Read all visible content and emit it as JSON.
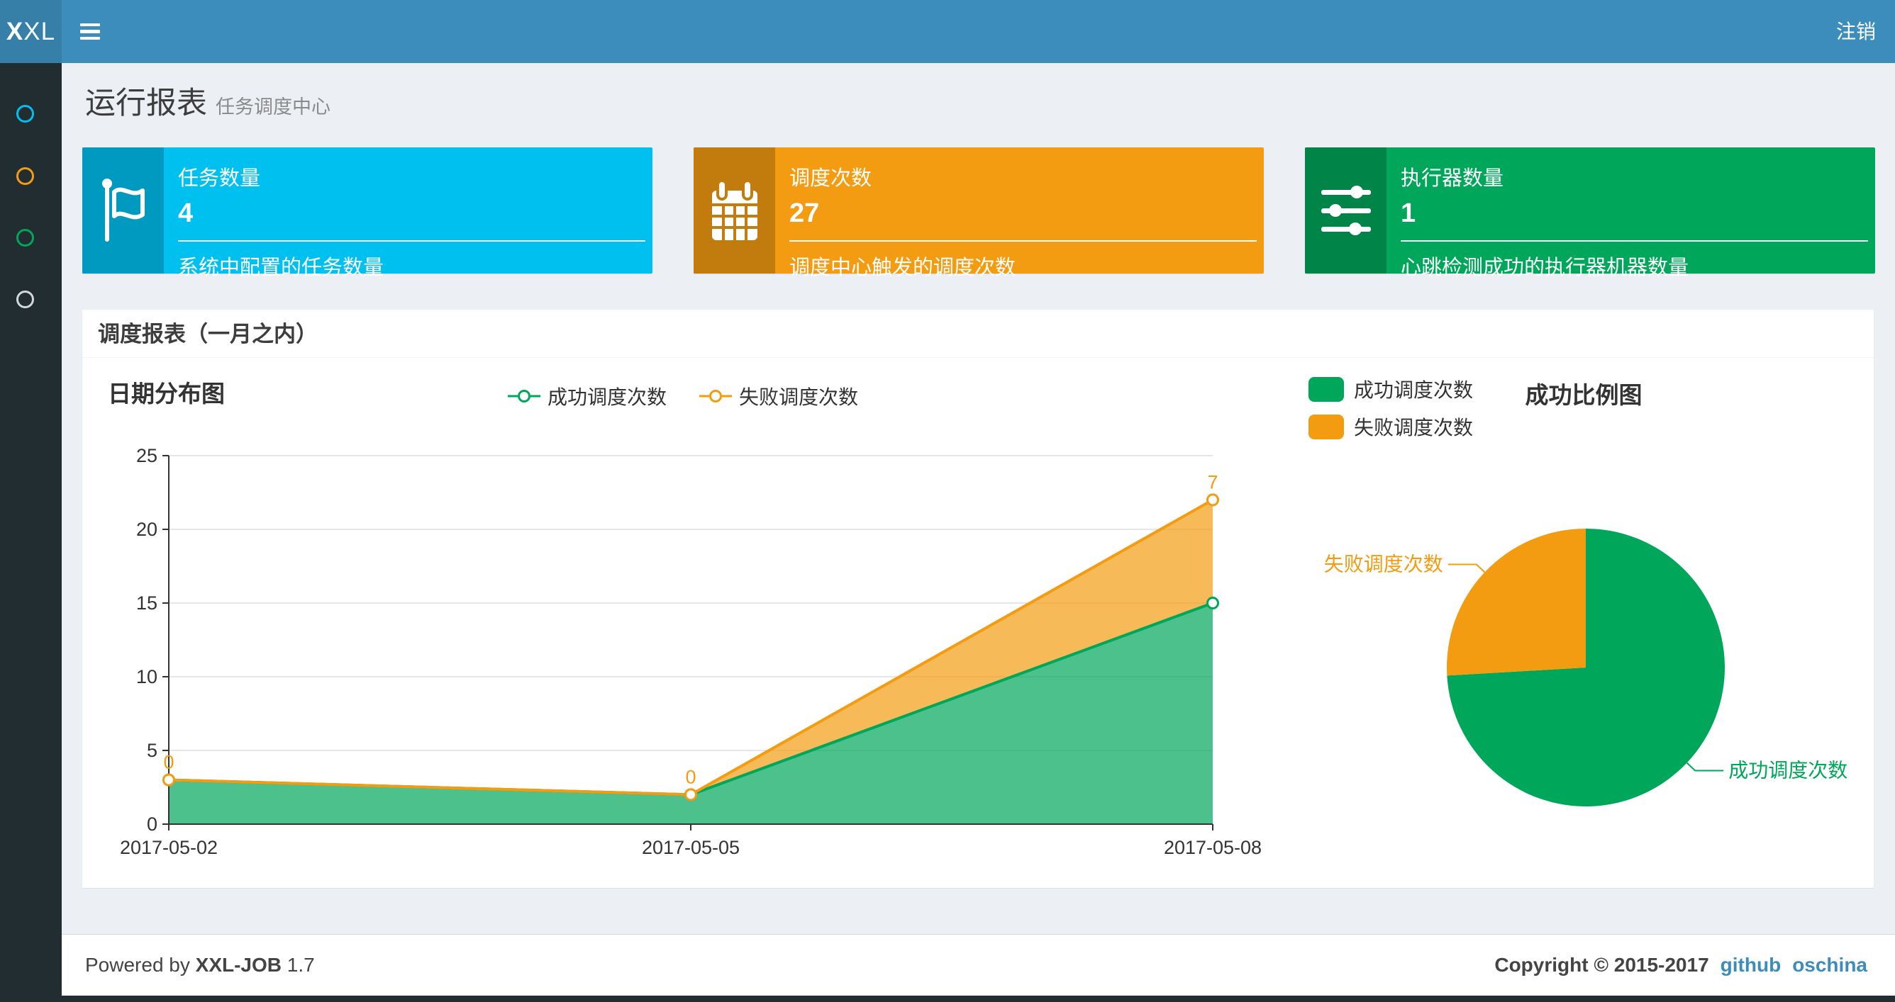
{
  "navbar": {
    "logo_bold": "X",
    "logo_rest": "XL",
    "logout": "注销"
  },
  "sidebar": {
    "items": [
      {
        "icon": "circle-o-icon",
        "color": "#00c0ef"
      },
      {
        "icon": "circle-o-icon",
        "color": "#f39c12"
      },
      {
        "icon": "circle-o-icon",
        "color": "#00a65a"
      },
      {
        "icon": "circle-o-icon",
        "color": "#d2d6de"
      }
    ]
  },
  "header": {
    "title": "运行报表",
    "subtitle": "任务调度中心"
  },
  "info_boxes": [
    {
      "label": "任务数量",
      "value": "4",
      "description": "系统中配置的任务数量",
      "color": "#00c0ef",
      "icon": "flag-icon"
    },
    {
      "label": "调度次数",
      "value": "27",
      "description": "调度中心触发的调度次数",
      "color": "#f39c12",
      "icon": "calendar-icon"
    },
    {
      "label": "执行器数量",
      "value": "1",
      "description": "心跳检测成功的执行器机器数量",
      "color": "#00a65a",
      "icon": "sliders-icon"
    }
  ],
  "panel": {
    "title": "调度报表（一月之内）"
  },
  "chart_data": [
    {
      "type": "area",
      "title": "日期分布图",
      "x": [
        "2017-05-02",
        "2017-05-05",
        "2017-05-08"
      ],
      "stacked": true,
      "series": [
        {
          "name": "成功调度次数",
          "values": [
            3,
            2,
            15
          ],
          "color": "#00a65a"
        },
        {
          "name": "失败调度次数",
          "values": [
            0,
            0,
            7
          ],
          "color": "#f39c12",
          "point_labels": [
            "0",
            "0",
            "7"
          ]
        }
      ],
      "ylim": [
        0,
        25
      ],
      "yticks": [
        0,
        5,
        10,
        15,
        20,
        25
      ],
      "grid": true,
      "legend_position": "top-center",
      "area_opacity": 0.7
    },
    {
      "type": "pie",
      "title": "成功比例图",
      "slices": [
        {
          "name": "成功调度次数",
          "value": 20,
          "color": "#00a65a",
          "label_side": "right"
        },
        {
          "name": "失败调度次数",
          "value": 7,
          "color": "#f39c12",
          "label_side": "left"
        }
      ],
      "start_angle": "top",
      "direction": "clockwise",
      "legend_position": "top-left"
    }
  ],
  "footer": {
    "powered_by": "Powered by",
    "product": "XXL-JOB",
    "version": "1.7",
    "copyright": "Copyright © 2015-2017",
    "links": [
      {
        "label": "github"
      },
      {
        "label": "oschina"
      }
    ]
  },
  "colors": {
    "navbar": "#3c8dbc",
    "logo_bg": "#367fa9",
    "sidebar": "#222d32",
    "content_bg": "#ecf0f5",
    "link": "#3c8dbc"
  }
}
